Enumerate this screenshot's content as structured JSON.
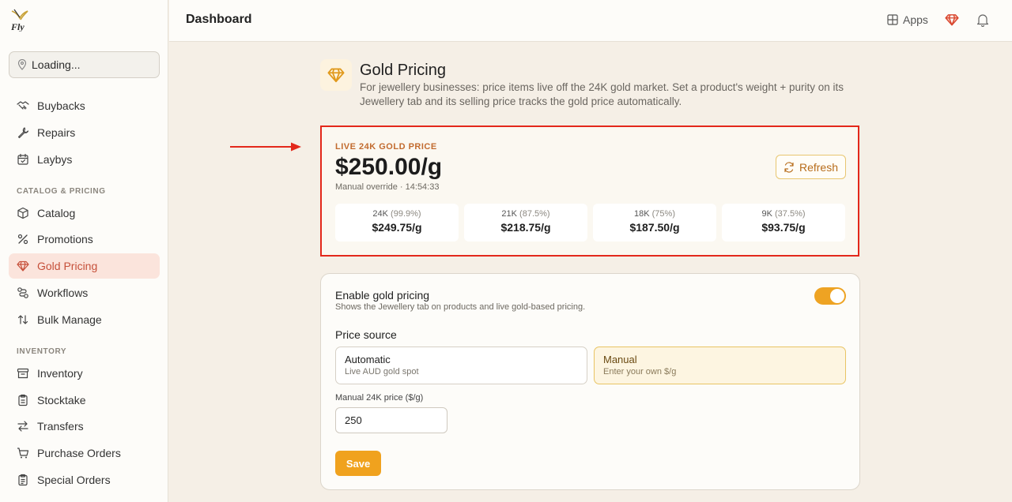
{
  "colors": {
    "accent": "#f0a21e",
    "active_nav_bg": "#fbe4dc",
    "active_nav_text": "#c6503a",
    "highlight_border": "#e3281b"
  },
  "brand": {
    "logo_text": "Fly"
  },
  "location": {
    "label": "Loading..."
  },
  "sidebar": {
    "items_top": [
      {
        "label": "Buybacks",
        "icon": "handshake-icon"
      },
      {
        "label": "Repairs",
        "icon": "wrench-icon"
      },
      {
        "label": "Laybys",
        "icon": "calendar-icon"
      }
    ],
    "section_catalog": "CATALOG & PRICING",
    "items_catalog": [
      {
        "label": "Catalog",
        "icon": "box-icon"
      },
      {
        "label": "Promotions",
        "icon": "percent-icon"
      },
      {
        "label": "Gold Pricing",
        "icon": "gem-icon",
        "active": true
      },
      {
        "label": "Workflows",
        "icon": "workflow-icon"
      },
      {
        "label": "Bulk Manage",
        "icon": "sort-arrows-icon"
      }
    ],
    "section_inventory": "INVENTORY",
    "items_inventory": [
      {
        "label": "Inventory",
        "icon": "archive-icon"
      },
      {
        "label": "Stocktake",
        "icon": "clipboard-icon"
      },
      {
        "label": "Transfers",
        "icon": "transfer-icon"
      },
      {
        "label": "Purchase Orders",
        "icon": "cart-icon"
      },
      {
        "label": "Special Orders",
        "icon": "clipboard-list-icon"
      }
    ]
  },
  "topbar": {
    "title": "Dashboard",
    "apps_label": "Apps"
  },
  "header": {
    "title": "Gold Pricing",
    "description": "For jewellery businesses: price items live off the 24K gold market. Set a product's weight + purity on its Jewellery tab and its selling price tracks the gold price automatically."
  },
  "gold": {
    "label": "LIVE 24K GOLD PRICE",
    "price": "$250.00/g",
    "subtitle": "Manual override · 14:54:33",
    "refresh_label": "Refresh",
    "purities": [
      {
        "name": "24K",
        "pct": "(99.9%)",
        "value": "$249.75/g"
      },
      {
        "name": "21K",
        "pct": "(87.5%)",
        "value": "$218.75/g"
      },
      {
        "name": "18K",
        "pct": "(75%)",
        "value": "$187.50/g"
      },
      {
        "name": "9K",
        "pct": "(37.5%)",
        "value": "$93.75/g"
      }
    ]
  },
  "settings": {
    "enable_title": "Enable gold pricing",
    "enable_desc": "Shows the Jewellery tab on products and live gold-based pricing.",
    "enabled": true,
    "price_source_label": "Price source",
    "options": [
      {
        "title": "Automatic",
        "desc": "Live AUD gold spot",
        "selected": false
      },
      {
        "title": "Manual",
        "desc": "Enter your own $/g",
        "selected": true
      }
    ],
    "manual_label": "Manual 24K price ($/g)",
    "manual_value": "250",
    "save_label": "Save"
  }
}
